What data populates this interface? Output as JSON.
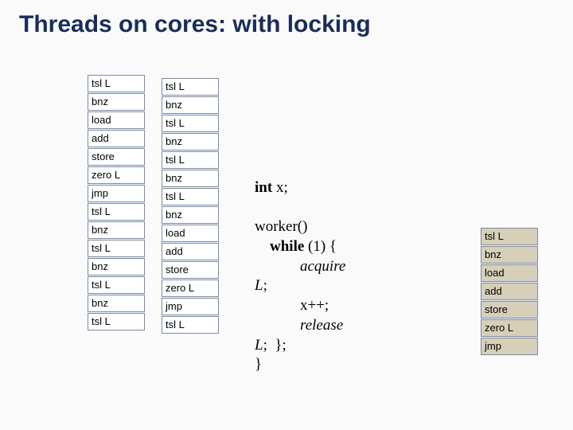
{
  "title": "Threads on cores: with locking",
  "col1": [
    "tsl L",
    "bnz",
    "load",
    "add",
    "store",
    "zero L",
    "jmp",
    "tsl L",
    "bnz",
    "tsl L",
    "bnz",
    "tsl L",
    "bnz",
    "tsl L"
  ],
  "col2": [
    "tsl L",
    "bnz",
    "tsl L",
    "bnz",
    "tsl L",
    "bnz",
    "tsl L",
    "bnz",
    "load",
    "add",
    "store",
    "zero L",
    "jmp",
    "tsl L"
  ],
  "col3": [
    "tsl L",
    "bnz",
    "load",
    "add",
    "store",
    "zero L",
    "jmp"
  ],
  "code": {
    "decl_kw": "int",
    "decl_rest": " x;",
    "fn": "worker()",
    "while_kw": "while",
    "while_rest": " (1) {",
    "acquire": "acquire",
    "lockvar1": "L",
    "semi1": ";",
    "stmt": "x++;",
    "release": "release",
    "lockvar2": "L",
    "closebrace1": ";  };",
    "closebrace2": "}"
  }
}
